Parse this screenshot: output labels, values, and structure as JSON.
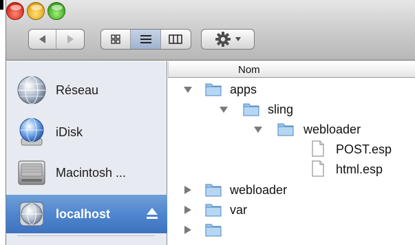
{
  "window": {
    "traffic_lights": [
      "close",
      "minimize",
      "zoom"
    ],
    "toolbar": {
      "nav": [
        "back-icon",
        "forward-icon"
      ],
      "views": [
        {
          "name": "icon-view",
          "active": false
        },
        {
          "name": "list-view",
          "active": true
        },
        {
          "name": "column-view",
          "active": false
        }
      ],
      "action": "gear-icon"
    }
  },
  "sidebar": {
    "items": [
      {
        "label": "Réseau",
        "icon": "network-globe-icon"
      },
      {
        "label": "iDisk",
        "icon": "idisk-globe-icon"
      },
      {
        "label": "Macintosh ...",
        "icon": "hard-drive-icon"
      },
      {
        "label": "localhost",
        "icon": "server-globe-icon",
        "selected": true,
        "eject": true
      }
    ]
  },
  "list": {
    "column_header": "Nom",
    "rows": [
      {
        "name": "apps",
        "level": 0,
        "kind": "folder",
        "expanded": true
      },
      {
        "name": "sling",
        "level": 1,
        "kind": "folder",
        "expanded": true
      },
      {
        "name": "webloader",
        "level": 2,
        "kind": "folder",
        "expanded": true
      },
      {
        "name": "POST.esp",
        "level": 3,
        "kind": "file"
      },
      {
        "name": "html.esp",
        "level": 3,
        "kind": "file"
      },
      {
        "name": "webloader",
        "level": 0,
        "kind": "folder",
        "expanded": false
      },
      {
        "name": "var",
        "level": 0,
        "kind": "folder",
        "expanded": false
      }
    ]
  },
  "colors": {
    "selection": "#4f86cf",
    "sidebar_bg": "#e7ebf1",
    "folder": "#8fc1ec"
  }
}
